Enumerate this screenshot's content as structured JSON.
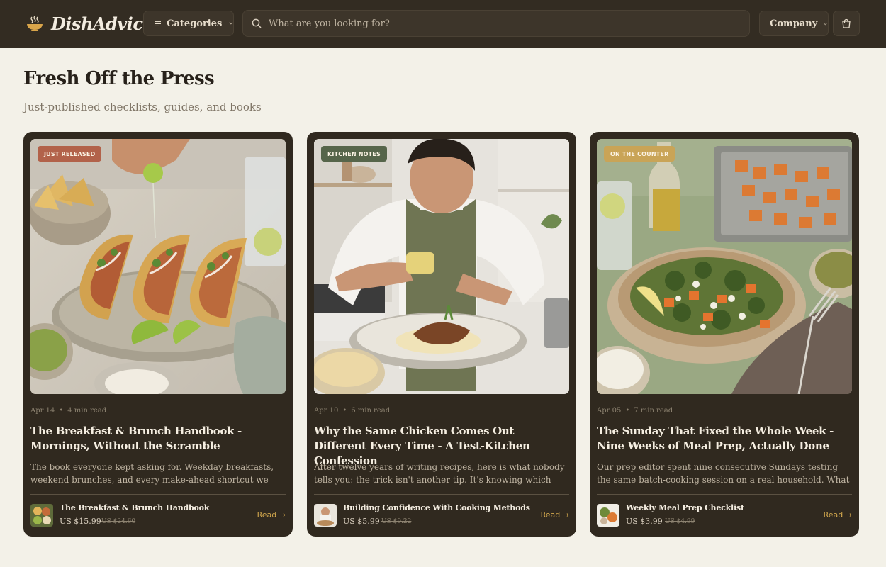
{
  "header": {
    "brand": "DishAdvice",
    "categories_label": "Categories",
    "search_placeholder": "What are you looking for?",
    "company_label": "Company"
  },
  "section": {
    "title": "Fresh Off the Press",
    "subtitle": "Just-published checklists, guides, and books"
  },
  "cards": [
    {
      "badge": "JUST RELEASED",
      "badge_color": "#b2624a",
      "date": "Apr 14",
      "read_time": "4 min read",
      "title": "The Breakfast & Brunch Handbook - Mornings, Without the Scramble",
      "excerpt": "The book everyone kept asking for. Weekday breakfasts, weekend brunches, and every make-ahead shortcut we lean on",
      "product_name": "The Breakfast & Brunch Handbook",
      "price": "US $15.99",
      "old_price": "US $24.60",
      "read_label": "Read →"
    },
    {
      "badge": "KITCHEN NOTES",
      "badge_color": "#56654a",
      "date": "Apr 10",
      "read_time": "6 min read",
      "title": "Why the Same Chicken Comes Out Different Every Time - A Test-Kitchen Confession",
      "excerpt": "After twelve years of writing recipes, here is what nobody tells you: the trick isn't another tip. It's knowing which cooking",
      "product_name": "Building Confidence With Cooking Methods",
      "price": "US $5.99",
      "old_price": "US $9.22",
      "read_label": "Read →"
    },
    {
      "badge": "ON THE COUNTER",
      "badge_color": "#c9a457",
      "date": "Apr 05",
      "read_time": "7 min read",
      "title": "The Sunday That Fixed the Whole Week - Nine Weeks of Meal Prep, Actually Done",
      "excerpt": "Our prep editor spent nine consecutive Sundays testing the same batch-cooking session on a real household. What she",
      "product_name": "Weekly Meal Prep Checklist",
      "price": "US $3.99",
      "old_price": "US $4.99",
      "read_label": "Read →"
    }
  ]
}
